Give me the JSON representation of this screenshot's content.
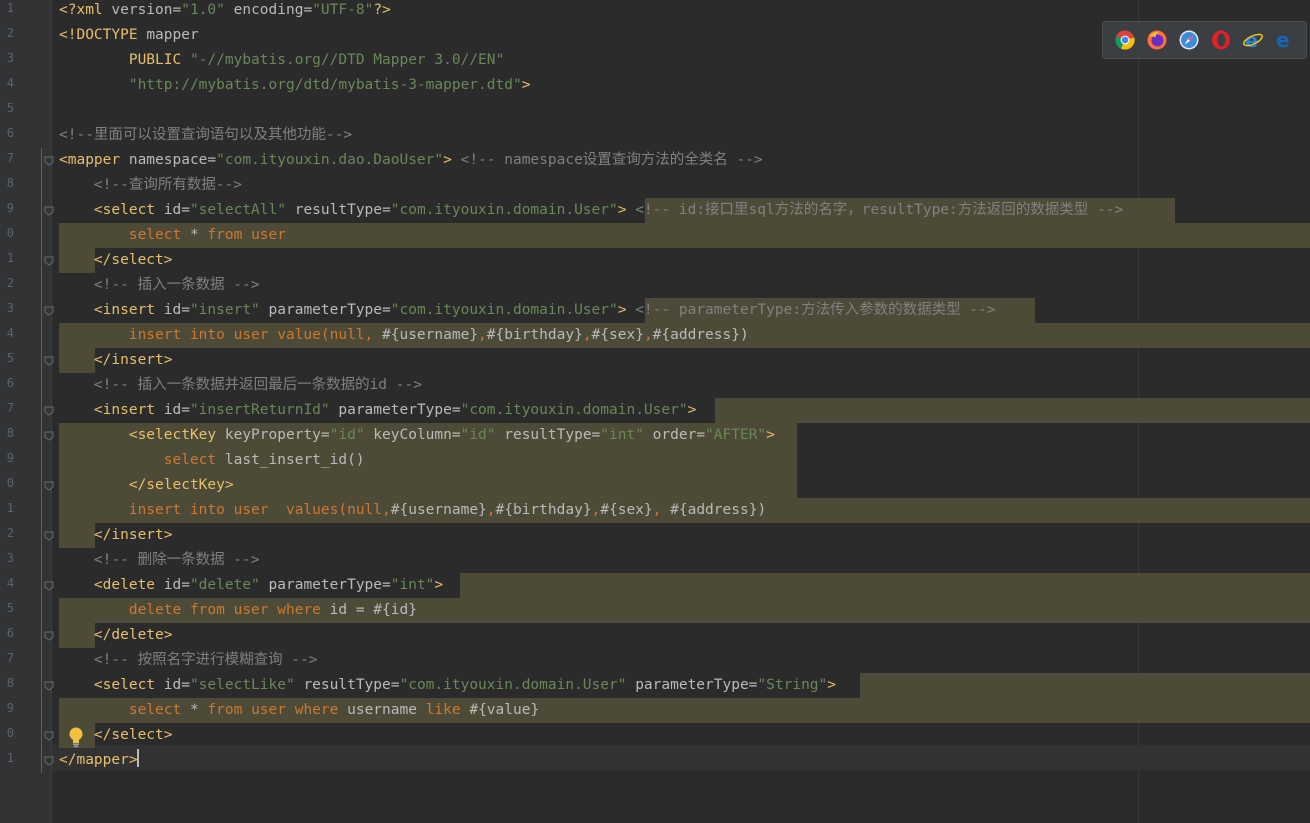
{
  "editor": {
    "line_numbers": [
      "1",
      "2",
      "3",
      "4",
      "5",
      "6",
      "7",
      "8",
      "9",
      "0",
      "1",
      "2",
      "3",
      "4",
      "5",
      "6",
      "7",
      "8",
      "9",
      "0",
      "1",
      "2",
      "3",
      "4",
      "5",
      "6",
      "7",
      "8",
      "9",
      "0",
      "1"
    ],
    "lines": [
      [
        {
          "t": "<?xml ",
          "c": "tag"
        },
        {
          "t": "version=",
          "c": "attr"
        },
        {
          "t": "\"1.0\"",
          "c": "str"
        },
        {
          "t": " encoding=",
          "c": "attr"
        },
        {
          "t": "\"UTF-8\"",
          "c": "str"
        },
        {
          "t": "?>",
          "c": "tag"
        }
      ],
      [
        {
          "t": "<!DOCTYPE ",
          "c": "tag"
        },
        {
          "t": "mapper",
          "c": "attr"
        }
      ],
      [
        {
          "t": "        PUBLIC ",
          "c": "tag"
        },
        {
          "t": "\"-//mybatis.org//DTD Mapper 3.0//EN\"",
          "c": "str"
        }
      ],
      [
        {
          "t": "        ",
          "c": "tag"
        },
        {
          "t": "\"http://mybatis.org/dtd/mybatis-3-mapper.dtd\"",
          "c": "str"
        },
        {
          "t": ">",
          "c": "tag"
        }
      ],
      [],
      [
        {
          "t": "<!--里面可以设置查询语句以及其他功能-->",
          "c": "cmt"
        }
      ],
      [
        {
          "t": "<mapper",
          "c": "tag"
        },
        {
          "t": " namespace=",
          "c": "attr"
        },
        {
          "t": "\"com.ityouxin.dao.DaoUser\"",
          "c": "str"
        },
        {
          "t": ">",
          "c": "tag"
        },
        {
          "t": " <!-- namespace设置查询方法的全类名 -->",
          "c": "cmt"
        }
      ],
      [
        {
          "t": "    <!--查询所有数据-->",
          "c": "cmt"
        }
      ],
      [
        {
          "t": "    <select",
          "c": "tag"
        },
        {
          "t": " id=",
          "c": "attr"
        },
        {
          "t": "\"selectAll\"",
          "c": "str"
        },
        {
          "t": " resultType=",
          "c": "attr"
        },
        {
          "t": "\"com.ityouxin.domain.User\"",
          "c": "str"
        },
        {
          "t": ">",
          "c": "tag"
        },
        {
          "t": " <!-- id:接口里sql方法的名字，resultType:方法返回的数据类型 -->",
          "c": "cmt"
        }
      ],
      [
        {
          "t": "        select ",
          "c": "kw"
        },
        {
          "t": "* ",
          "c": "attr"
        },
        {
          "t": "from ",
          "c": "kw"
        },
        {
          "t": "user",
          "c": "kw"
        }
      ],
      [
        {
          "t": "    </select>",
          "c": "tag"
        }
      ],
      [
        {
          "t": "    <!-- 插入一条数据 -->",
          "c": "cmt"
        }
      ],
      [
        {
          "t": "    <insert",
          "c": "tag"
        },
        {
          "t": " id=",
          "c": "attr"
        },
        {
          "t": "\"insert\"",
          "c": "str"
        },
        {
          "t": " parameterType=",
          "c": "attr"
        },
        {
          "t": "\"com.ityouxin.domain.User\"",
          "c": "str"
        },
        {
          "t": ">",
          "c": "tag"
        },
        {
          "t": " <!-- parameterType:方法传入参数的数据类型 -->",
          "c": "cmt"
        }
      ],
      [
        {
          "t": "        insert into user value(",
          "c": "kw"
        },
        {
          "t": "null, ",
          "c": "kw"
        },
        {
          "t": "#{username}",
          "c": "attr"
        },
        {
          "t": ",",
          "c": "kw"
        },
        {
          "t": "#{birthday}",
          "c": "attr"
        },
        {
          "t": ",",
          "c": "kw"
        },
        {
          "t": "#{sex}",
          "c": "attr"
        },
        {
          "t": ",",
          "c": "kw"
        },
        {
          "t": "#{address})",
          "c": "attr"
        }
      ],
      [
        {
          "t": "    </insert>",
          "c": "tag"
        }
      ],
      [
        {
          "t": "    <!-- 插入一条数据并返回最后一条数据的id -->",
          "c": "cmt"
        }
      ],
      [
        {
          "t": "    <insert",
          "c": "tag"
        },
        {
          "t": " id=",
          "c": "attr"
        },
        {
          "t": "\"insertReturnId\"",
          "c": "str"
        },
        {
          "t": " parameterType=",
          "c": "attr"
        },
        {
          "t": "\"com.ityouxin.domain.User\"",
          "c": "str"
        },
        {
          "t": ">",
          "c": "tag"
        }
      ],
      [
        {
          "t": "        <selectKey",
          "c": "tag"
        },
        {
          "t": " keyProperty=",
          "c": "attr"
        },
        {
          "t": "\"id\"",
          "c": "str"
        },
        {
          "t": " keyColumn=",
          "c": "attr"
        },
        {
          "t": "\"id\"",
          "c": "str"
        },
        {
          "t": " resultType=",
          "c": "attr"
        },
        {
          "t": "\"int\"",
          "c": "str"
        },
        {
          "t": " order=",
          "c": "attr"
        },
        {
          "t": "\"AFTER\"",
          "c": "str"
        },
        {
          "t": ">",
          "c": "tag"
        }
      ],
      [
        {
          "t": "            select ",
          "c": "kw"
        },
        {
          "t": "last_insert_id()",
          "c": "attr"
        }
      ],
      [
        {
          "t": "        </selectKey>",
          "c": "tag"
        }
      ],
      [
        {
          "t": "        insert into user  values(",
          "c": "kw"
        },
        {
          "t": "null,",
          "c": "kw"
        },
        {
          "t": "#{username}",
          "c": "attr"
        },
        {
          "t": ",",
          "c": "kw"
        },
        {
          "t": "#{birthday}",
          "c": "attr"
        },
        {
          "t": ",",
          "c": "kw"
        },
        {
          "t": "#{sex}",
          "c": "attr"
        },
        {
          "t": ", ",
          "c": "kw"
        },
        {
          "t": "#{address})",
          "c": "attr"
        }
      ],
      [
        {
          "t": "    </insert>",
          "c": "tag"
        }
      ],
      [
        {
          "t": "    <!-- 删除一条数据 -->",
          "c": "cmt"
        }
      ],
      [
        {
          "t": "    <delete",
          "c": "tag"
        },
        {
          "t": " id=",
          "c": "attr"
        },
        {
          "t": "\"delete\"",
          "c": "str"
        },
        {
          "t": " parameterType=",
          "c": "attr"
        },
        {
          "t": "\"int\"",
          "c": "str"
        },
        {
          "t": ">",
          "c": "tag"
        }
      ],
      [
        {
          "t": "        delete from user where ",
          "c": "kw"
        },
        {
          "t": "id = #{id}",
          "c": "attr"
        }
      ],
      [
        {
          "t": "    </delete>",
          "c": "tag"
        }
      ],
      [
        {
          "t": "    <!-- 按照名字进行模糊查询 -->",
          "c": "cmt"
        }
      ],
      [
        {
          "t": "    <select",
          "c": "tag"
        },
        {
          "t": " id=",
          "c": "attr"
        },
        {
          "t": "\"selectLike\"",
          "c": "str"
        },
        {
          "t": " resultType=",
          "c": "attr"
        },
        {
          "t": "\"com.ityouxin.domain.User\"",
          "c": "str"
        },
        {
          "t": " parameterType=",
          "c": "attr"
        },
        {
          "t": "\"String\"",
          "c": "str"
        },
        {
          "t": ">",
          "c": "tag"
        }
      ],
      [
        {
          "t": "        select ",
          "c": "kw"
        },
        {
          "t": "* ",
          "c": "attr"
        },
        {
          "t": "from user where ",
          "c": "kw"
        },
        {
          "t": "username ",
          "c": "attr"
        },
        {
          "t": "like ",
          "c": "kw"
        },
        {
          "t": "#{value}",
          "c": "attr"
        }
      ],
      [
        {
          "t": "    </select>",
          "c": "tag"
        }
      ],
      [
        {
          "t": "</mapper>",
          "c": "tag"
        }
      ]
    ]
  },
  "browsers": [
    {
      "name": "chrome-icon",
      "color": "#4caf50"
    },
    {
      "name": "firefox-icon",
      "color": "#ff7139"
    },
    {
      "name": "safari-icon",
      "color": "#3a8dde"
    },
    {
      "name": "opera-icon",
      "color": "#e0202a"
    },
    {
      "name": "ie-icon",
      "color": "#1e88e5"
    },
    {
      "name": "edge-icon",
      "color": "#1565c0"
    }
  ]
}
